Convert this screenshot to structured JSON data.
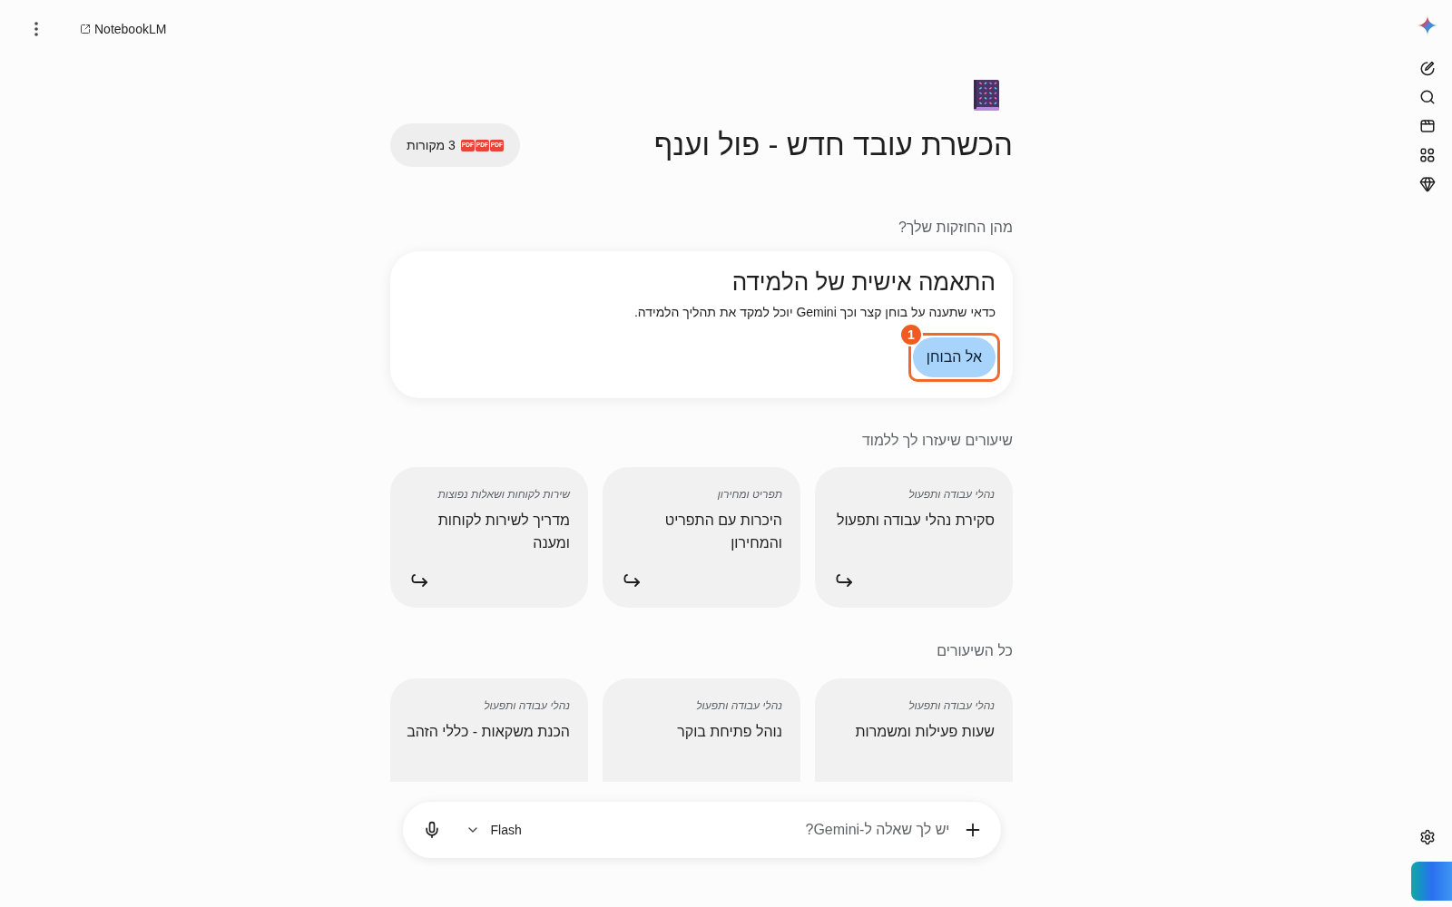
{
  "top_bar": {
    "link": "NotebookLM"
  },
  "notebook": {
    "title": "הכשרת עובד חדש - פול וענף",
    "sources": {
      "files": [
        {
          "type": "PDF"
        },
        {
          "type": "PDF"
        },
        {
          "type": "PDF"
        }
      ],
      "label": "3 מקורות"
    }
  },
  "strengths": {
    "heading": "מהן החוזקות שלך?",
    "card": {
      "title": "התאמה אישית של הלמידה",
      "text": "כדאי שתענה על בוחן קצר וכך Gemini יוכל למקד את תהליך הלמידה.",
      "button": {
        "label": "אל הבוחן",
        "callout": "1"
      }
    }
  },
  "recommended_lessons": {
    "heading": "שיעורים שיעזרו לך ללמוד",
    "lessons": [
      {
        "category": "נהלי עבודה ותפעול",
        "title": "סקירת נהלי עבודה ותפעול"
      },
      {
        "category": "תפריט ומחירון",
        "title": "היכרות עם התפריט והמחירון"
      },
      {
        "category": "שירות לקוחות ושאלות נפוצות",
        "title": "מדריך לשירות לקוחות ומענה"
      }
    ]
  },
  "all_lessons": {
    "heading": "כל השיעורים",
    "lessons": [
      {
        "category": "נהלי עבודה ותפעול",
        "title": "שעות פעילות ומשמרות"
      },
      {
        "category": "נהלי עבודה ותפעול",
        "title": "נוהל פתיחת בוקר"
      },
      {
        "category": "נהלי עבודה ותפעול",
        "title": "הכנת משקאות - כללי הזהב"
      }
    ]
  },
  "composer": {
    "placeholder": "יש לך שאלה ל-Gemini?",
    "model": "Flash"
  }
}
